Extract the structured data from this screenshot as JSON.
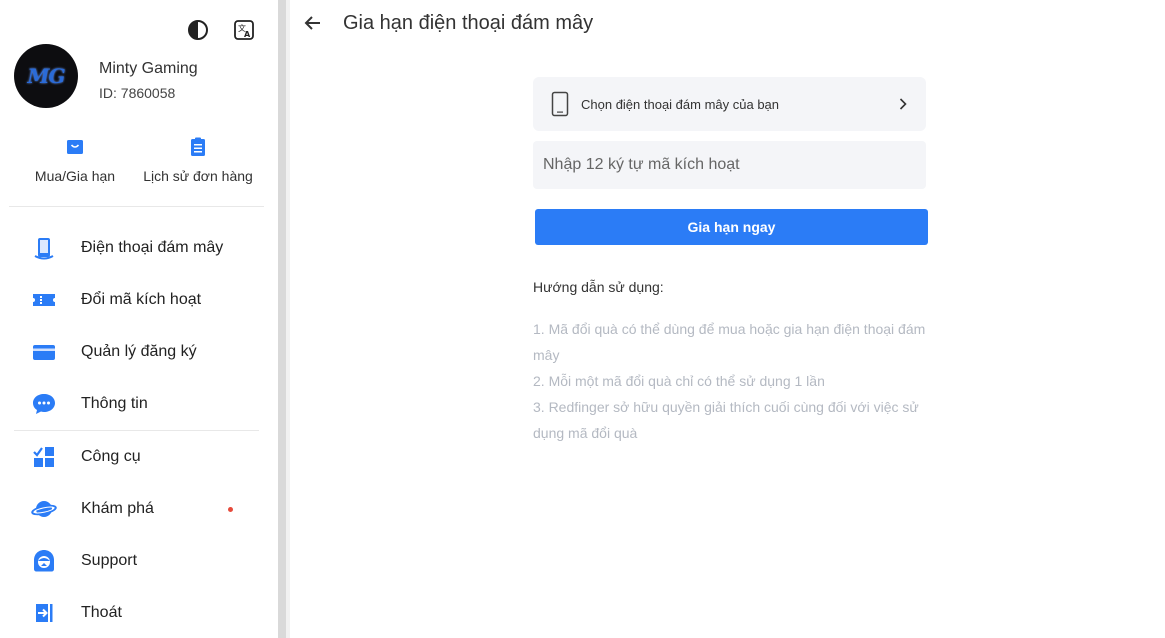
{
  "user": {
    "avatar_text": "MG",
    "name": "Minty Gaming",
    "id_text": "ID: 7860058"
  },
  "top_icons": [
    "theme-contrast-icon",
    "translate-icon"
  ],
  "quick_actions": [
    {
      "label": "Mua/Gia hạn",
      "icon": "shopping-bag-icon"
    },
    {
      "label": "Lịch sử đơn hàng",
      "icon": "clipboard-list-icon"
    }
  ],
  "menu": [
    {
      "label": "Điện thoại đám mây",
      "icon": "cloud-phone-icon"
    },
    {
      "label": "Đổi mã kích hoạt",
      "icon": "ticket-icon"
    },
    {
      "label": "Quản lý đăng ký",
      "icon": "card-icon"
    },
    {
      "label": "Thông tin",
      "icon": "chat-bubble-icon"
    },
    {
      "label": "Công cụ",
      "icon": "tools-grid-icon"
    },
    {
      "label": "Khám phá",
      "icon": "planet-icon",
      "badge_dot": true
    },
    {
      "label": "Support",
      "icon": "support-agent-icon"
    },
    {
      "label": "Thoát",
      "icon": "logout-icon"
    }
  ],
  "main": {
    "title": "Gia hạn điện thoại đám mây",
    "phone_select_label": "Chọn điện thoại đám mây của bạn",
    "code_placeholder": "Nhập 12 ký tự mã kích hoạt",
    "renew_button": "Gia hạn ngay",
    "guide_title": "Hướng dẫn sử dụng:",
    "guide_items": [
      "1. Mã đổi quà có thể dùng để mua hoặc gia hạn điện thoại đám mây",
      "2. Mỗi một mã đổi quà chỉ có thể sử dụng 1 lần",
      "3. Redfinger sở hữu quyền giải thích cuối cùng đối với việc sử dụng mã đổi quà"
    ]
  },
  "colors": {
    "accent": "#2b7cf6",
    "icon_blue": "#2b7cf6",
    "badge_red": "#e64a3b"
  }
}
